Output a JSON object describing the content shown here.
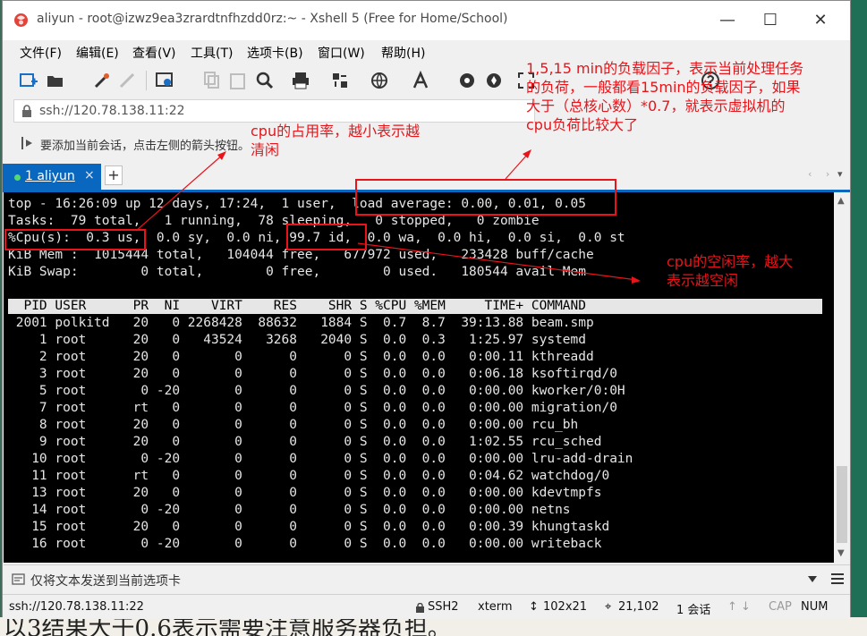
{
  "window": {
    "title": "aliyun - root@izwz9ea3zrardtnfhzdd0rz:~ - Xshell 5 (Free for Home/School)",
    "minimize": "—",
    "maximize": "☐",
    "close": "✕"
  },
  "menu": [
    "文件(F)",
    "编辑(E)",
    "查看(V)",
    "工具(T)",
    "选项卡(B)",
    "窗口(W)",
    "帮助(H)"
  ],
  "address": {
    "value": "ssh://120.78.138.11:22"
  },
  "hint": {
    "text": "要添加当前会话，点击左侧的箭头按钮。"
  },
  "tabs": {
    "active_label": "1 aliyun",
    "close": "×",
    "add": "+",
    "nav": "‹ ›",
    "list": "▾"
  },
  "terminal": {
    "lines": [
      "top - 16:26:09 up 12 days, 17:24,  1 user,  load average: 0.00, 0.01, 0.05",
      "Tasks:  79 total,   1 running,  78 sleeping,   0 stopped,   0 zombie",
      "%Cpu(s):  0.3 us,  0.0 sy,  0.0 ni, 99.7 id,  0.0 wa,  0.0 hi,  0.0 si,  0.0 st",
      "KiB Mem :  1015444 total,   104044 free,   677972 used,   233428 buff/cache",
      "KiB Swap:        0 total,        0 free,        0 used.   180544 avail Mem"
    ],
    "header": "  PID USER      PR  NI    VIRT    RES    SHR S %CPU %MEM     TIME+ COMMAND",
    "rows": [
      " 2001 polkitd   20   0 2268428  88632   1884 S  0.7  8.7  39:13.88 beam.smp",
      "    1 root      20   0   43524   3268   2040 S  0.0  0.3   1:25.97 systemd",
      "    2 root      20   0       0      0      0 S  0.0  0.0   0:00.11 kthreadd",
      "    3 root      20   0       0      0      0 S  0.0  0.0   0:06.18 ksoftirqd/0",
      "    5 root       0 -20       0      0      0 S  0.0  0.0   0:00.00 kworker/0:0H",
      "    7 root      rt   0       0      0      0 S  0.0  0.0   0:00.00 migration/0",
      "    8 root      20   0       0      0      0 S  0.0  0.0   0:00.00 rcu_bh",
      "    9 root      20   0       0      0      0 S  0.0  0.0   1:02.55 rcu_sched",
      "   10 root       0 -20       0      0      0 S  0.0  0.0   0:00.00 lru-add-drain",
      "   11 root      rt   0       0      0      0 S  0.0  0.0   0:04.62 watchdog/0",
      "   13 root      20   0       0      0      0 S  0.0  0.0   0:00.00 kdevtmpfs",
      "   14 root       0 -20       0      0      0 S  0.0  0.0   0:00.00 netns",
      "   15 root      20   0       0      0      0 S  0.0  0.0   0:00.39 khungtaskd",
      "   16 root       0 -20       0      0      0 S  0.0  0.0   0:00.00 writeback"
    ]
  },
  "send_bar": {
    "text": "仅将文本发送到当前选项卡"
  },
  "status": {
    "conn": "ssh://120.78.138.11:22",
    "proto": "SSH2",
    "term": "xterm",
    "size": "102x21",
    "pos": "21,102",
    "sessions": "1 会话",
    "arrows": "↑ ↓",
    "cap": "CAP",
    "num": "NUM"
  },
  "annotations": {
    "load_note": [
      "1,5,15 min的负载因子，表示当前处理任务",
      "的负荷，一般都看15min的负载因子，如果",
      "大于（总核心数）*0.7，就表示虚拟机的",
      "cpu负荷比较大了"
    ],
    "cpu_usage_note": [
      "cpu的占用率，越小表示越",
      "清闲"
    ],
    "cpu_idle_note": [
      "cpu的空闲率，越大",
      "表示越空闲"
    ]
  },
  "background": {
    "text": "以3结果大于0.6表示需要注意服务器负担。"
  },
  "colors": {
    "accent": "#0a67c0",
    "annotation": "#e8141a",
    "terminal_bg": "#000000",
    "terminal_fg": "#e6e6e6"
  }
}
